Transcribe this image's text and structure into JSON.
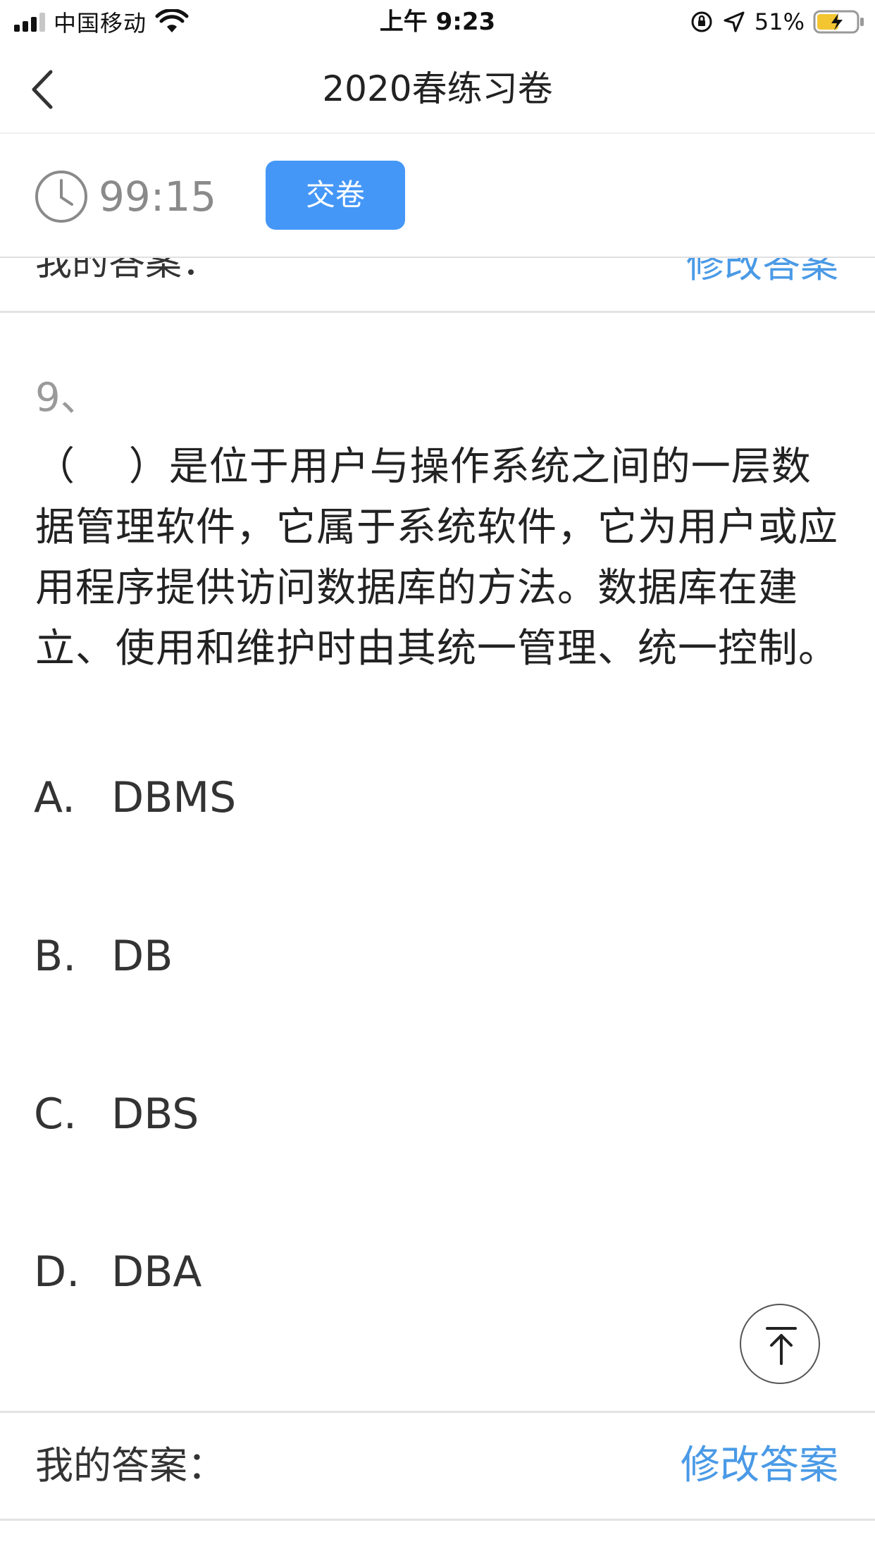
{
  "status_bar": {
    "carrier": "中国移动",
    "time": "上午 9:23",
    "battery_percent": "51%",
    "icons": [
      "signal-icon",
      "wifi-icon",
      "orientation-lock-icon",
      "location-icon",
      "battery-charging-icon"
    ]
  },
  "nav": {
    "title": "2020春练习卷",
    "back_icon": "chevron-left-icon"
  },
  "timer": {
    "icon": "clock-icon",
    "remaining": "99:15",
    "submit_label": "交卷"
  },
  "previous_answer": {
    "label": "我的答案：",
    "edit_label": "修改答案"
  },
  "question": {
    "number": "9、",
    "text": "（　 ）是位于用户与操作系统之间的一层数据管理软件，它属于系统软件，它为用户或应用程序提供访问数据库的方法。数据库在建立、使用和维护时由其统一管理、统一控制。",
    "options": [
      {
        "letter": "A.",
        "text": "DBMS"
      },
      {
        "letter": "B.",
        "text": "DB"
      },
      {
        "letter": "C.",
        "text": "DBS"
      },
      {
        "letter": "D.",
        "text": "DBA"
      }
    ]
  },
  "answer": {
    "label": "我的答案：",
    "edit_label": "修改答案"
  },
  "colors": {
    "accent": "#4597f7",
    "link": "#4a9ae6",
    "timer_text": "#8a8a8a"
  }
}
